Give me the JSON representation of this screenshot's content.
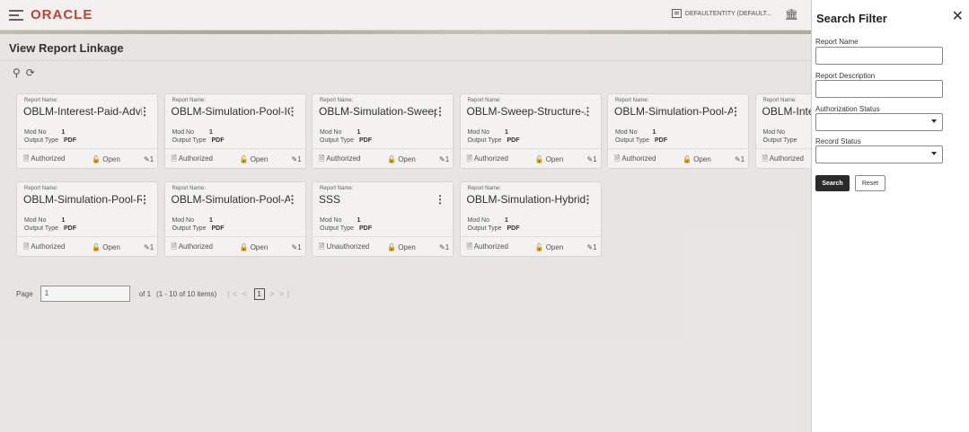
{
  "app": {
    "logo": "ORACLE",
    "entity": "DEFAULTENTITY (DEFAULT...",
    "page_title": "View Report Linkage"
  },
  "labels": {
    "report_name": "Report Name:",
    "mod_no": "Mod No",
    "output_type": "Output Type"
  },
  "cards": [
    {
      "name": "OBLM-Interest-Paid-Advice",
      "mod": "1",
      "output": "PDF",
      "status": "Authorized",
      "lock": "Open",
      "count": "1"
    },
    {
      "name": "OBLM-Simulation-Pool-IO...",
      "mod": "1",
      "output": "PDF",
      "status": "Authorized",
      "lock": "Open",
      "count": "1"
    },
    {
      "name": "OBLM-Simulation-Sweep-...",
      "mod": "1",
      "output": "PDF",
      "status": "Authorized",
      "lock": "Open",
      "count": "1"
    },
    {
      "name": "OBLM-Sweep-Structure-A...",
      "mod": "1",
      "output": "PDF",
      "status": "Authorized",
      "lock": "Open",
      "count": "1"
    },
    {
      "name": "OBLM-Simulation-Pool-A...",
      "mod": "1",
      "output": "PDF",
      "status": "Authorized",
      "lock": "Open",
      "count": "1"
    },
    {
      "name": "OBLM-Intere",
      "mod": "",
      "output": "",
      "status": "Authorized",
      "lock": "",
      "count": ""
    },
    {
      "name": "OBLM-Simulation-Pool-R...",
      "mod": "1",
      "output": "PDF",
      "status": "Authorized",
      "lock": "Open",
      "count": "1"
    },
    {
      "name": "OBLM-Simulation-Pool-A...",
      "mod": "1",
      "output": "PDF",
      "status": "Authorized",
      "lock": "Open",
      "count": "1"
    },
    {
      "name": "SSS",
      "mod": "1",
      "output": "PDF",
      "status": "Unauthorized",
      "lock": "Open",
      "count": "1"
    },
    {
      "name": "OBLM-Simulation-Hybrid...",
      "mod": "1",
      "output": "PDF",
      "status": "Authorized",
      "lock": "Open",
      "count": "1"
    }
  ],
  "pager": {
    "page_label": "Page",
    "page_value": "1",
    "of_text": "of 1",
    "range_text": "(1 - 10 of 10 items)",
    "current": "1"
  },
  "filter": {
    "title": "Search Filter",
    "fields": [
      {
        "label": "Report Name",
        "value": ""
      },
      {
        "label": "Report Description",
        "value": ""
      },
      {
        "label": "Authorization Status",
        "value": ""
      },
      {
        "label": "Record Status",
        "value": ""
      }
    ],
    "search_label": "Search",
    "reset_label": "Reset"
  },
  "icons": [
    "menu-icon",
    "entity-icon",
    "bank-icon",
    "search-icon",
    "refresh-icon",
    "kebab-icon",
    "document-icon",
    "lock-icon",
    "edit-icon",
    "close-icon"
  ]
}
